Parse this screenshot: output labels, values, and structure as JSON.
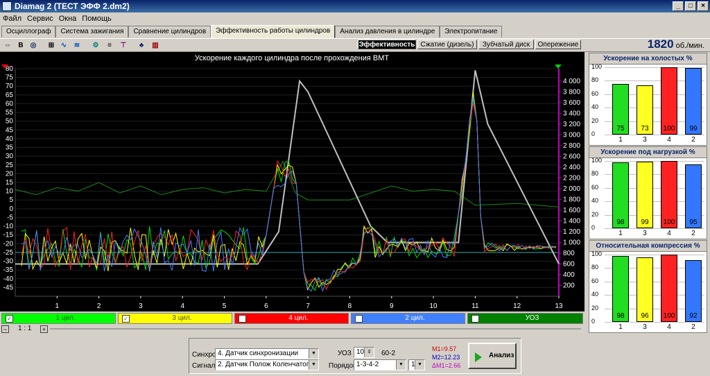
{
  "window": {
    "title": "Diamag 2 (ТЕСТ ЭФФ 2.dm2)",
    "minimize": "_",
    "maximize": "□",
    "close": "×"
  },
  "menu": [
    "Файл",
    "Сервис",
    "Окна",
    "Помощь"
  ],
  "tabs": [
    "Осциллограф",
    "Система зажигания",
    "Сравнение цилиндров",
    "Эффективность работы цилиндров",
    "Анализ давления в цилиндре",
    "Электропитание"
  ],
  "active_tab": "Эффективность работы цилиндров",
  "toolbar_icons": [
    "ruler-icon",
    "bold-b-icon",
    "scope-icon",
    "measure-icon",
    "wave-icon",
    "wave-multi-icon",
    "gear-icon",
    "list-icon",
    "filter-icon",
    "tool-icon",
    "bars-icon"
  ],
  "subtabs": [
    "Эффективность",
    "Сжатие (дизель)",
    "Зубчатый диск",
    "Опережение"
  ],
  "rpm": {
    "value": "1820",
    "unit": "об./мин."
  },
  "chart_data": {
    "type": "line",
    "title": "Ускорение каждого цилиндра после прохождения ВМТ",
    "x_ticks": [
      1,
      2,
      3,
      4,
      5,
      6,
      7,
      8,
      9,
      10,
      11,
      12,
      13
    ],
    "xlim": [
      0,
      13
    ],
    "y_left_ticks": [
      80,
      75,
      70,
      65,
      60,
      55,
      50,
      45,
      40,
      35,
      30,
      25,
      20,
      15,
      10,
      5,
      0,
      -5,
      -10,
      -15,
      -20,
      -25,
      -30,
      -35,
      -40,
      -45
    ],
    "ylim_left": [
      -50,
      80
    ],
    "y_right_ticks": [
      "4 000",
      "3 800",
      "3 600",
      "3 400",
      "3 200",
      "3 000",
      "2 800",
      "2 600",
      "2 400",
      "2 200",
      "2 000",
      "1 800",
      "1 600",
      "1 400",
      "1 200",
      "1 000",
      "800",
      "600",
      "400",
      "200"
    ],
    "ylim_right": [
      0,
      4230
    ],
    "series": [
      {
        "name": "1 цил.",
        "color": "#00e000"
      },
      {
        "name": "3 цил.",
        "color": "#ffff00"
      },
      {
        "name": "4 цил.",
        "color": "#ff2020"
      },
      {
        "name": "2 цил.",
        "color": "#4080ff"
      },
      {
        "name": "УОЗ",
        "color": "#1a8a1a"
      }
    ],
    "rpm_trace_color": "#c0c0c0",
    "rpm_trace": [
      [
        0,
        600
      ],
      [
        5.8,
        600
      ],
      [
        6.3,
        1200
      ],
      [
        6.8,
        4000
      ],
      [
        7,
        3800
      ],
      [
        8.5,
        1300
      ],
      [
        8.9,
        1000
      ],
      [
        10.6,
        1000
      ],
      [
        11,
        4200
      ],
      [
        11.3,
        3200
      ],
      [
        13,
        600
      ]
    ],
    "uoz_trace": [
      [
        0,
        11
      ],
      [
        0.5,
        8
      ],
      [
        1,
        12
      ],
      [
        1.5,
        10
      ],
      [
        2,
        15
      ],
      [
        2.5,
        9
      ],
      [
        3,
        13
      ],
      [
        3.5,
        8
      ],
      [
        4,
        11
      ],
      [
        4.5,
        12
      ],
      [
        5,
        9
      ],
      [
        5.5,
        11
      ],
      [
        6,
        10
      ],
      [
        6.4,
        27
      ],
      [
        6.7,
        9
      ],
      [
        7,
        5
      ],
      [
        8,
        5
      ],
      [
        9,
        13
      ],
      [
        9.5,
        10
      ],
      [
        10,
        11
      ],
      [
        10.5,
        10
      ],
      [
        11,
        2
      ],
      [
        12,
        3
      ],
      [
        13,
        1
      ]
    ]
  },
  "legend": [
    {
      "label": "1 цил.",
      "bg": "#00ff00",
      "fg": "#006000"
    },
    {
      "label": "3 цил.",
      "bg": "#ffff00",
      "fg": "#505000"
    },
    {
      "label": "4 цил.",
      "bg": "#ff0000",
      "fg": "#ffffff"
    },
    {
      "label": "2 цил.",
      "bg": "#4080ff",
      "fg": "#ffffff"
    },
    {
      "label": "УОЗ",
      "bg": "#008000",
      "fg": "#ffffff"
    }
  ],
  "scale": {
    "value": "1 : 1"
  },
  "panels": [
    {
      "title": "Ускорение на холостых %",
      "cyl": [
        "1",
        "3",
        "4",
        "2"
      ],
      "values": [
        75,
        73,
        100,
        99
      ]
    },
    {
      "title": "Ускорение под нагрузкой %",
      "cyl": [
        "1",
        "3",
        "4",
        "2"
      ],
      "values": [
        98,
        99,
        100,
        95
      ]
    },
    {
      "title": "Относительная компрессия %",
      "cyl": [
        "1",
        "3",
        "4",
        "2"
      ],
      "values": [
        98,
        96,
        100,
        92
      ]
    }
  ],
  "panel_ticks": [
    "100",
    "80",
    "60",
    "40",
    "20",
    "0"
  ],
  "bar_colors": [
    "#22dd22",
    "#ffff22",
    "#ff2222",
    "#3377ff"
  ],
  "controls": {
    "sync_label": "Синхро:",
    "sync_value": "4. Датчик синхронизации",
    "signal_label": "Сигнал:",
    "signal_value": "2. Датчик Полож Коленчатого Вал",
    "uoz_label": "УОЗ",
    "uoz_value": "10",
    "teeth": "60-2",
    "order_label": "Порядок",
    "order_value": "1-3-4-2",
    "order_extra": "1",
    "m1": "M1=9.57",
    "m2": "M2=12.23",
    "dm": "ΔM1=2.66",
    "analyze": "Анализ"
  }
}
